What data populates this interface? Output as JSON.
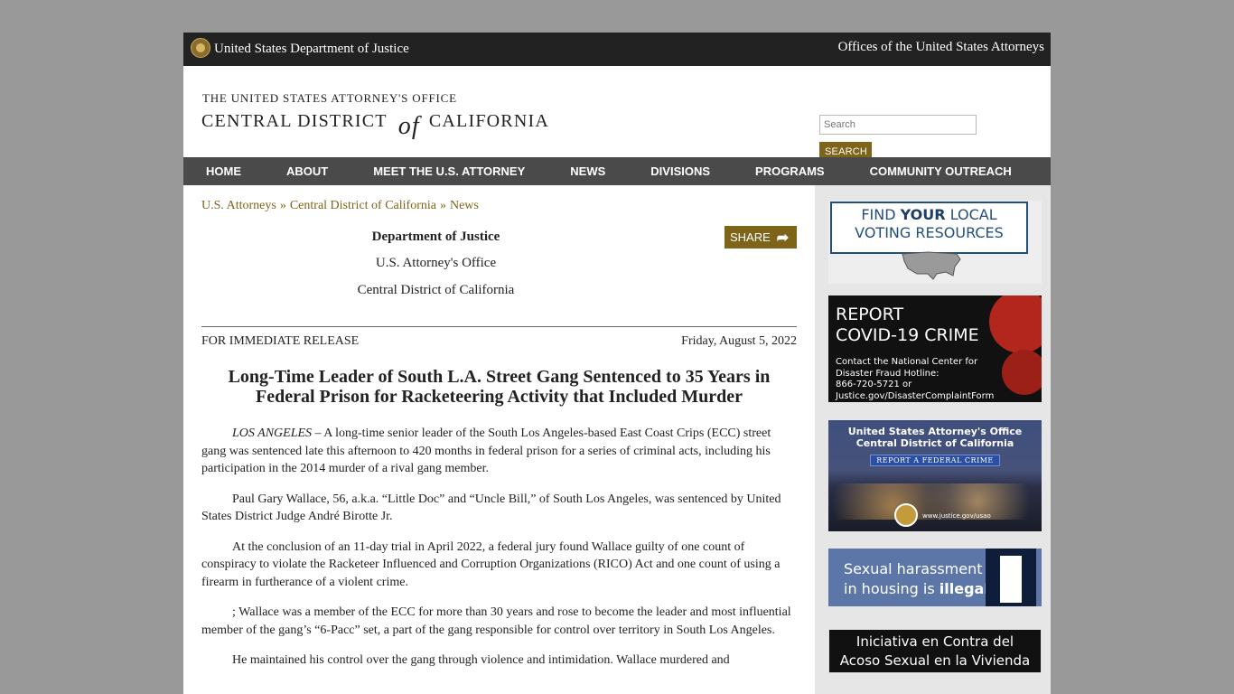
{
  "topbar": {
    "agency": "United States Department of Justice",
    "offices_link": "Offices of the United States Attorneys"
  },
  "header": {
    "line1": "THE UNITED STATES ATTORNEY'S OFFICE",
    "line2_left": "CENTRAL DISTRICT",
    "line2_of": "of",
    "line2_right": "CALIFORNIA"
  },
  "search": {
    "placeholder": "Search",
    "button": "SEARCH"
  },
  "nav": [
    "HOME",
    "ABOUT",
    "MEET THE U.S. ATTORNEY",
    "NEWS",
    "DIVISIONS",
    "PROGRAMS",
    "COMMUNITY OUTREACH"
  ],
  "breadcrumb": {
    "items": [
      "U.S. Attorneys",
      "Central District of California",
      "News"
    ],
    "separator": "»"
  },
  "release_head": {
    "dept": "Department of Justice",
    "office": "U.S. Attorney's Office",
    "district": "Central District of California",
    "share": "SHARE"
  },
  "release": {
    "label": "FOR IMMEDIATE RELEASE",
    "date": "Friday, August 5, 2022"
  },
  "article": {
    "title": "Long-Time Leader of South L.A. Street Gang Sentenced to 35 Years in Federal Prison for Racketeering Activity that Included Murder",
    "dateline": "LOS ANGELES",
    "p1": " – A long-time senior leader of the South Los Angeles-based East Coast Crips (ECC) street gang was sentenced late this afternoon to 420 months in federal prison for a series of criminal acts, including his participation in the 2014 murder of a rival gang member.",
    "p2": "Paul Gary Wallace, 56, a.k.a. “Little Doc” and “Uncle Bill,” of South Los Angeles, was sentenced by United States District Judge André Birotte Jr.",
    "p3": "At the conclusion of an 11-day trial in April 2022, a federal jury found Wallace guilty of one count of conspiracy to violate the Racketeer Influenced and Corruption Organizations (RICO) Act and one count of using a firearm in furtherance of a violent crime.",
    "p4": "; Wallace was a member of the ECC for more than 30 years and rose to become the leader and most influential member of the gang’s “6-Pacc” set, a part of the gang responsible for control over territory in South Los Angeles.",
    "p5": "He maintained his control over the gang through violence and intimidation. Wallace murdered and"
  },
  "sidebar": {
    "ad_voting": {
      "line1": "FIND",
      "line1_bold": "YOUR",
      "line1_end": "LOCAL",
      "line2": "VOTING RESOURCES"
    },
    "ad_covid": {
      "line1": "REPORT",
      "line2": "COVID-19 CRIME",
      "small1": "Contact the National Center for",
      "small2": "Disaster Fraud Hotline:",
      "small3": "866-720-5721 or",
      "small4": "Justice.gov/DisasterComplaintForm"
    },
    "ad_report": {
      "line1": "United States Attorney's Office",
      "line2": "Central District of California",
      "bar": "REPORT A FEDERAL CRIME",
      "url": "www.justice.gov/usao"
    },
    "ad_harassment": {
      "line1": "Sexual harassment",
      "line2a": "in housing is",
      "line2b": "illegal."
    },
    "ad_iniciativa": {
      "line1": "Iniciativa en Contra del",
      "line2": "Acoso Sexual en la Vivienda"
    }
  },
  "colors": {
    "gold": "#7d6418",
    "topbar": "#222222",
    "nav": "#4a4a4a",
    "background": "#999999"
  }
}
